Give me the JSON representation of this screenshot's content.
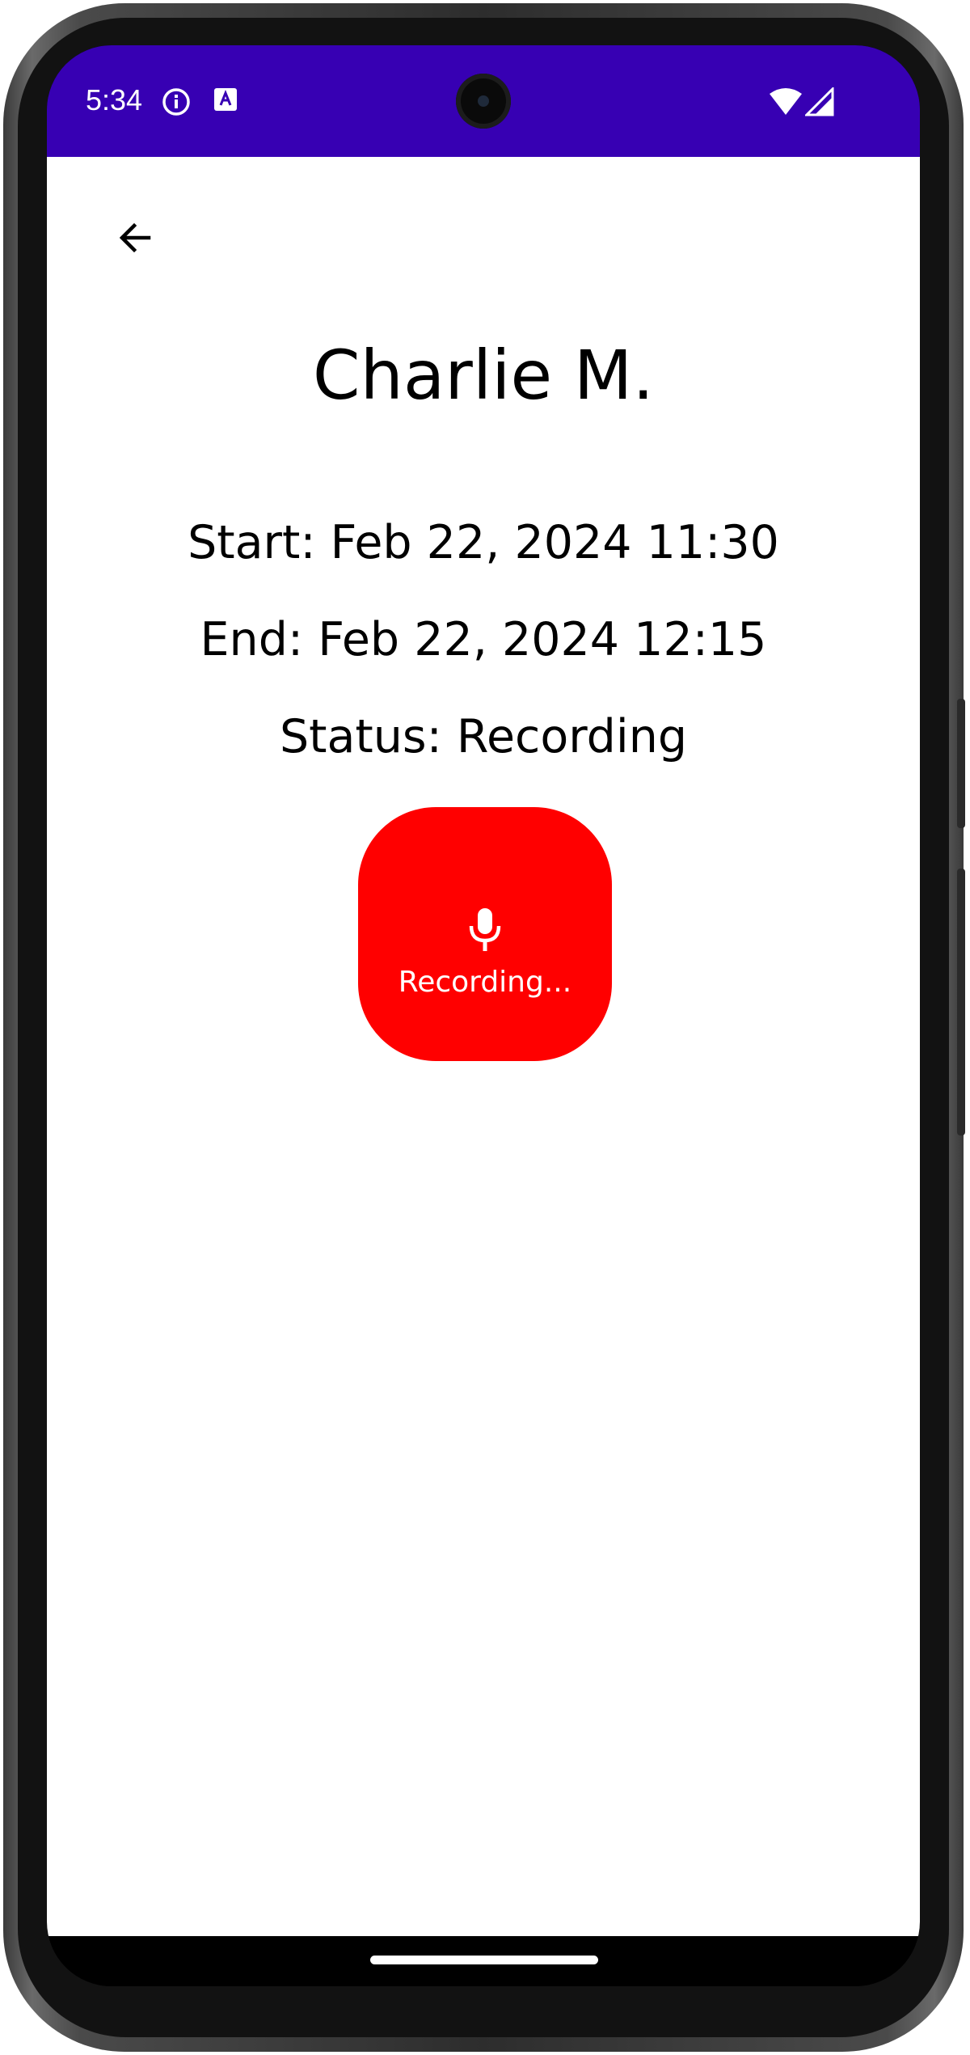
{
  "status_bar": {
    "time": "5:34",
    "background_color": "#3700b3",
    "left_icons": [
      "info-icon",
      "text-accessibility-icon"
    ],
    "right_icons": [
      "wifi-icon",
      "cellular-signal-icon"
    ]
  },
  "toolbar": {
    "back_icon": "arrow-left-icon"
  },
  "recording": {
    "name": "Charlie M.",
    "start": "Start: Feb 22, 2024 11:30",
    "end": "End: Feb 22, 2024 12:15",
    "status": "Status: Recording"
  },
  "record_button": {
    "label": "Recording...",
    "icon": "microphone-icon",
    "color": "#ff0000"
  }
}
